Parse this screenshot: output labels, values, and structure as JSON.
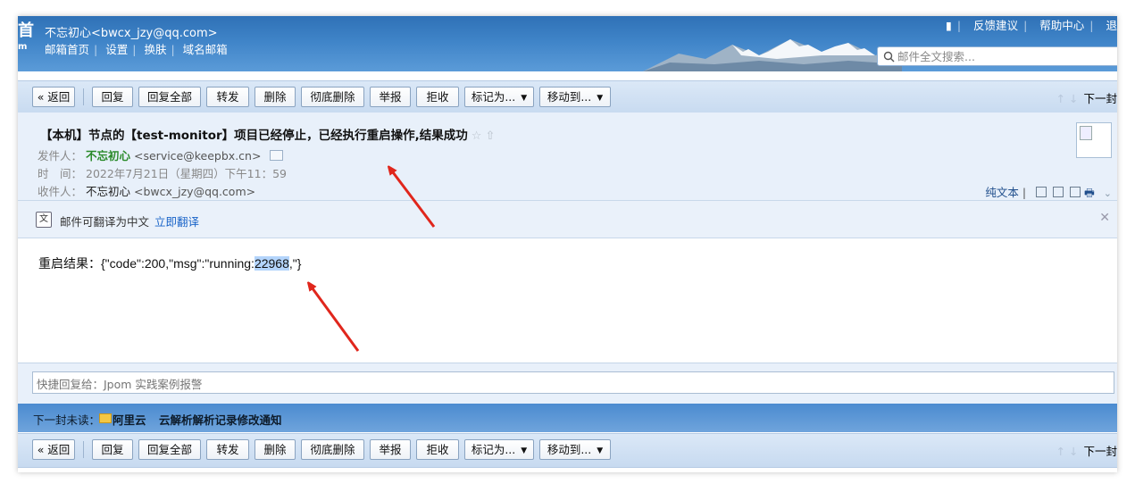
{
  "header": {
    "logo_fragment_top": "首",
    "logo_fragment_bottom": "m",
    "user_display": "不忘初心<bwcx_jzy@qq.com>",
    "nav": [
      "邮箱首页",
      "设置",
      "换肤",
      "域名邮箱"
    ],
    "top_links": [
      "反馈建议",
      "帮助中心",
      "退"
    ],
    "search_placeholder": "邮件全文搜索..."
  },
  "toolbar": {
    "back": "« 返回",
    "reply": "回复",
    "reply_all": "回复全部",
    "forward": "转发",
    "delete": "删除",
    "delete_forever": "彻底删除",
    "report": "举报",
    "reject": "拒收",
    "mark_as": "标记为...",
    "move_to": "移动到...",
    "next": "下一封"
  },
  "mail": {
    "subject": "【本机】节点的【test-monitor】项目已经停止，已经执行重启操作,结果成功",
    "from_label": "发件人：",
    "from_name": "不忘初心",
    "from_addr": "<service@keepbx.cn>",
    "time_label": "时　间：",
    "time_value": "2022年7月21日（星期四）下午11：59",
    "to_label": "收件人：",
    "to_name": "不忘初心",
    "to_addr": "<bwcx_jzy@qq.com>",
    "plain_text": "纯文本",
    "body_prefix": "重启结果：{\"code\":200,\"msg\":\"running:",
    "body_highlight": "22968",
    "body_suffix": ",\"}"
  },
  "translate": {
    "text": "邮件可翻译为中文",
    "action": "立即翻译"
  },
  "quick_reply": {
    "placeholder": "快捷回复给：Jpom 实践案例报警"
  },
  "next_unread": {
    "label": "下一封未读：",
    "sender": "阿里云",
    "subject": "云解析解析记录修改通知"
  },
  "colors": {
    "header_blue": "#3f84c8",
    "toolbar_bg": "#d2e2f4",
    "annotation_red": "#e0261c",
    "highlight": "#b3d4fb"
  }
}
